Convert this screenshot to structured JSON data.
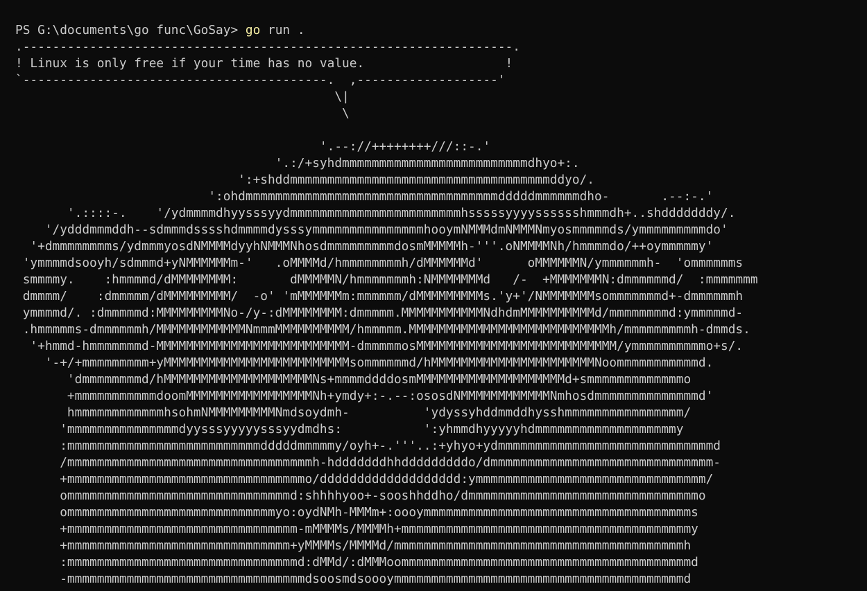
{
  "terminal": {
    "prompt": "PS G:\\documents\\go func\\GoSay> ",
    "command": "go",
    "args": " run .",
    "colors": {
      "background": "#0c0c0c",
      "foreground": "#cccccc",
      "command_highlight": "#f9f1a5"
    }
  },
  "bubble": [
    ".------------------------------------------------------------------.",
    "! Linux is only free if your time has no value.                   !",
    "`-----------------------------------------.  ,-------------------'",
    "                                           \\|",
    "                                            \\"
  ],
  "art": [
    "",
    "                                         '.--://++++++++///::-.'",
    "                                   '.:/+syhdmmmmmmmmmmmmmmmmmmmmmmmmmdhyo+:.",
    "                              ':+shddmmmmmmmmmmmmmmmmmmmmmmmmmmmmmmmmmmmddyo/.",
    "                          ':ohdmmmmmmmmmmmmmmmmmmmmmmmmmmmmmmmmmmdddddmmmmmmdho-       .--:-.'",
    "       '.::::-.    '/ydmmmmdhyysssyydmmmmmmmmmmmmmmmmmmmmmmmhsssssyyyysssssshmmmdh+..shdddddddy/.",
    "    '/ydddmmmddh--sdmmmdsssshdmmmmdysssymmmmmmmmmmmmmmmhooymNMMMdmNMMMNmyosmmmmmds/ymmmmmmmmmdo'",
    "  '+dmmmmmmmms/ydmmmyosdNMMMMdyyhNMMMNhosdmmmmmmmmmdosmMMMMMh-'''.oNMMMMNh/hmmmmdo/++oymmmmmy'",
    " 'ymmmmdsooyh/sdmmmd+yNMMMMMMm-'   .oMMMMd/hmmmmmmmmh/dMMMMMMd'      oMMMMMMN/ymmmmmmh-  'ommmmmms",
    " smmmmy.    :hmmmmd/dMMMMMMMM:       dMMMMMN/hmmmmmmmh:NMMMMMMMd   /-  +MMMMMMMN:dmmmmmmd/  :mmmmmmm",
    " dmmmm/    :dmmmmm/dMMMMMMMMM/  -o' 'mMMMMMMm:mmmmmm/dMMMMMMMMMs.'y+'/NMMMMMMMsommmmmmmd+-dmmmmmmh",
    " ymmmmd/. :dmmmmmd:MMMMMMMMMNo-/y-:dMMMMMMMM:dmmmmm.MMMMMMMMMMMNdhdmMMMMMMMMMMd/mmmmmmmmd:ymmmmmd-",
    " .hmmmmms-dmmmmmmh/MMMMMMMMMMMMNmmmMMMMMMMMMM/hmmmmm.MMMMMMMMMMMMMMMMMMMMMMMMMMMh/mmmmmmmmmh-dmmds.",
    "  '+hmmd-hmmmmmmmd-MMMMMMMMMMMMMMMMMMMMMMMMMM-dmmmmmosMMMMMMMMMMMMMMMMMMMMMMMMMMM/ymmmmmmmmmmo+s/.",
    "    '-+/+mmmmmmmmm+yMMMMMMMMMMMMMMMMMMMMMMMMMsommmmmmd/hMMMMMMMMMMMMMMMMMMMMMMNoommmmmmmmmmmd.",
    "       'dmmmmmmmmd/hMMMMMMMMMMMMMMMMMMMMNs+mmmmddddosmMMMMMMMMMMMMMMMMMMMMd+smmmmmmmmmmmmmo",
    "       +mmmmmmmmmmmdoomMMMMMMMMMMMMMMMMMNh+ymdy+:-.--:ososdNMMMMMMMMMMMMNmhosdmmmmmmmmmmmmmmd'",
    "       hmmmmmmmmmmmmhsohmNMMMMMMMMMNmdsoydmh-          'ydyssyhddmmddhysshmmmmmmmmmmmmmmmm/",
    "      'mmmmmmmmmmmmmmmdyysssyyyyysssyydmdhs:           ':yhmmdhyyyyyhdmmmmmmmmmmmmmmmmmmmy",
    "      :mmmmmmmmmmmmmmmmmmmmmmmmmmdddddmmmmmy/oyh+-.'''..:+yhyo+ydmmmmmmmmmmmmmmmmmmmmmmmmmmmmmd",
    "      /mmmmmmmmmmmmmmmmmmmmmmmmmmmmmmmmmh-hdddddddhhdddddddddo/dmmmmmmmmmmmmmmmmmmmmmmmmmmmmmm-",
    "      +mmmmmmmmmmmmmmmmmmmmmmmmmmmmmmmmo/ddddddddddddddddddd:ymmmmmmmmmmmmmmmmmmmmmmmmmmmmmmm/",
    "      ommmmmmmmmmmmmmmmmmmmmmmmmmmmmmd:shhhhyoo+-sooshhddho/dmmmmmmmmmmmmmmmmmmmmmmmmmmmmmmmo",
    "      ommmmmmmmmmmmmmmmmmmmmmmmmmmmyo:oydNMh-MMMm+:oooymmmmmmmmmmmmmmmmmmmmmmmmmmmmmmmmmmmms",
    "      +mmmmmmmmmmmmmmmmmmmmmmmmmmmmmmm-mMMMMs/MMMMh+mmmmmmmmmmmmmmmmmmmmmmmmmmmmmmmmmmmmmmmy",
    "      +mmmmmmmmmmmmmmmmmmmmmmmmmmmmmm+yMMMMs/MMMMd/mmmmmmmmmmmmmmmmmmmmmmmmmmmmmmmmmmmmmmmh",
    "      :mmmmmmmmmmmmmmmmmmmmmmmmmmmmmmmd:dMMd/:dMMMoommmmmmmmmmmmmmmmmmmmmmmmmmmmmmmmmmmmmmmd",
    "      -mmmmmmmmmmmmmmmmmmmmmmmmmmmmmmmmdsoosmdsoooymmmmmmmmmmmmmmmmmmmmmmmmmmmmmmmmmmmmmmmd"
  ]
}
